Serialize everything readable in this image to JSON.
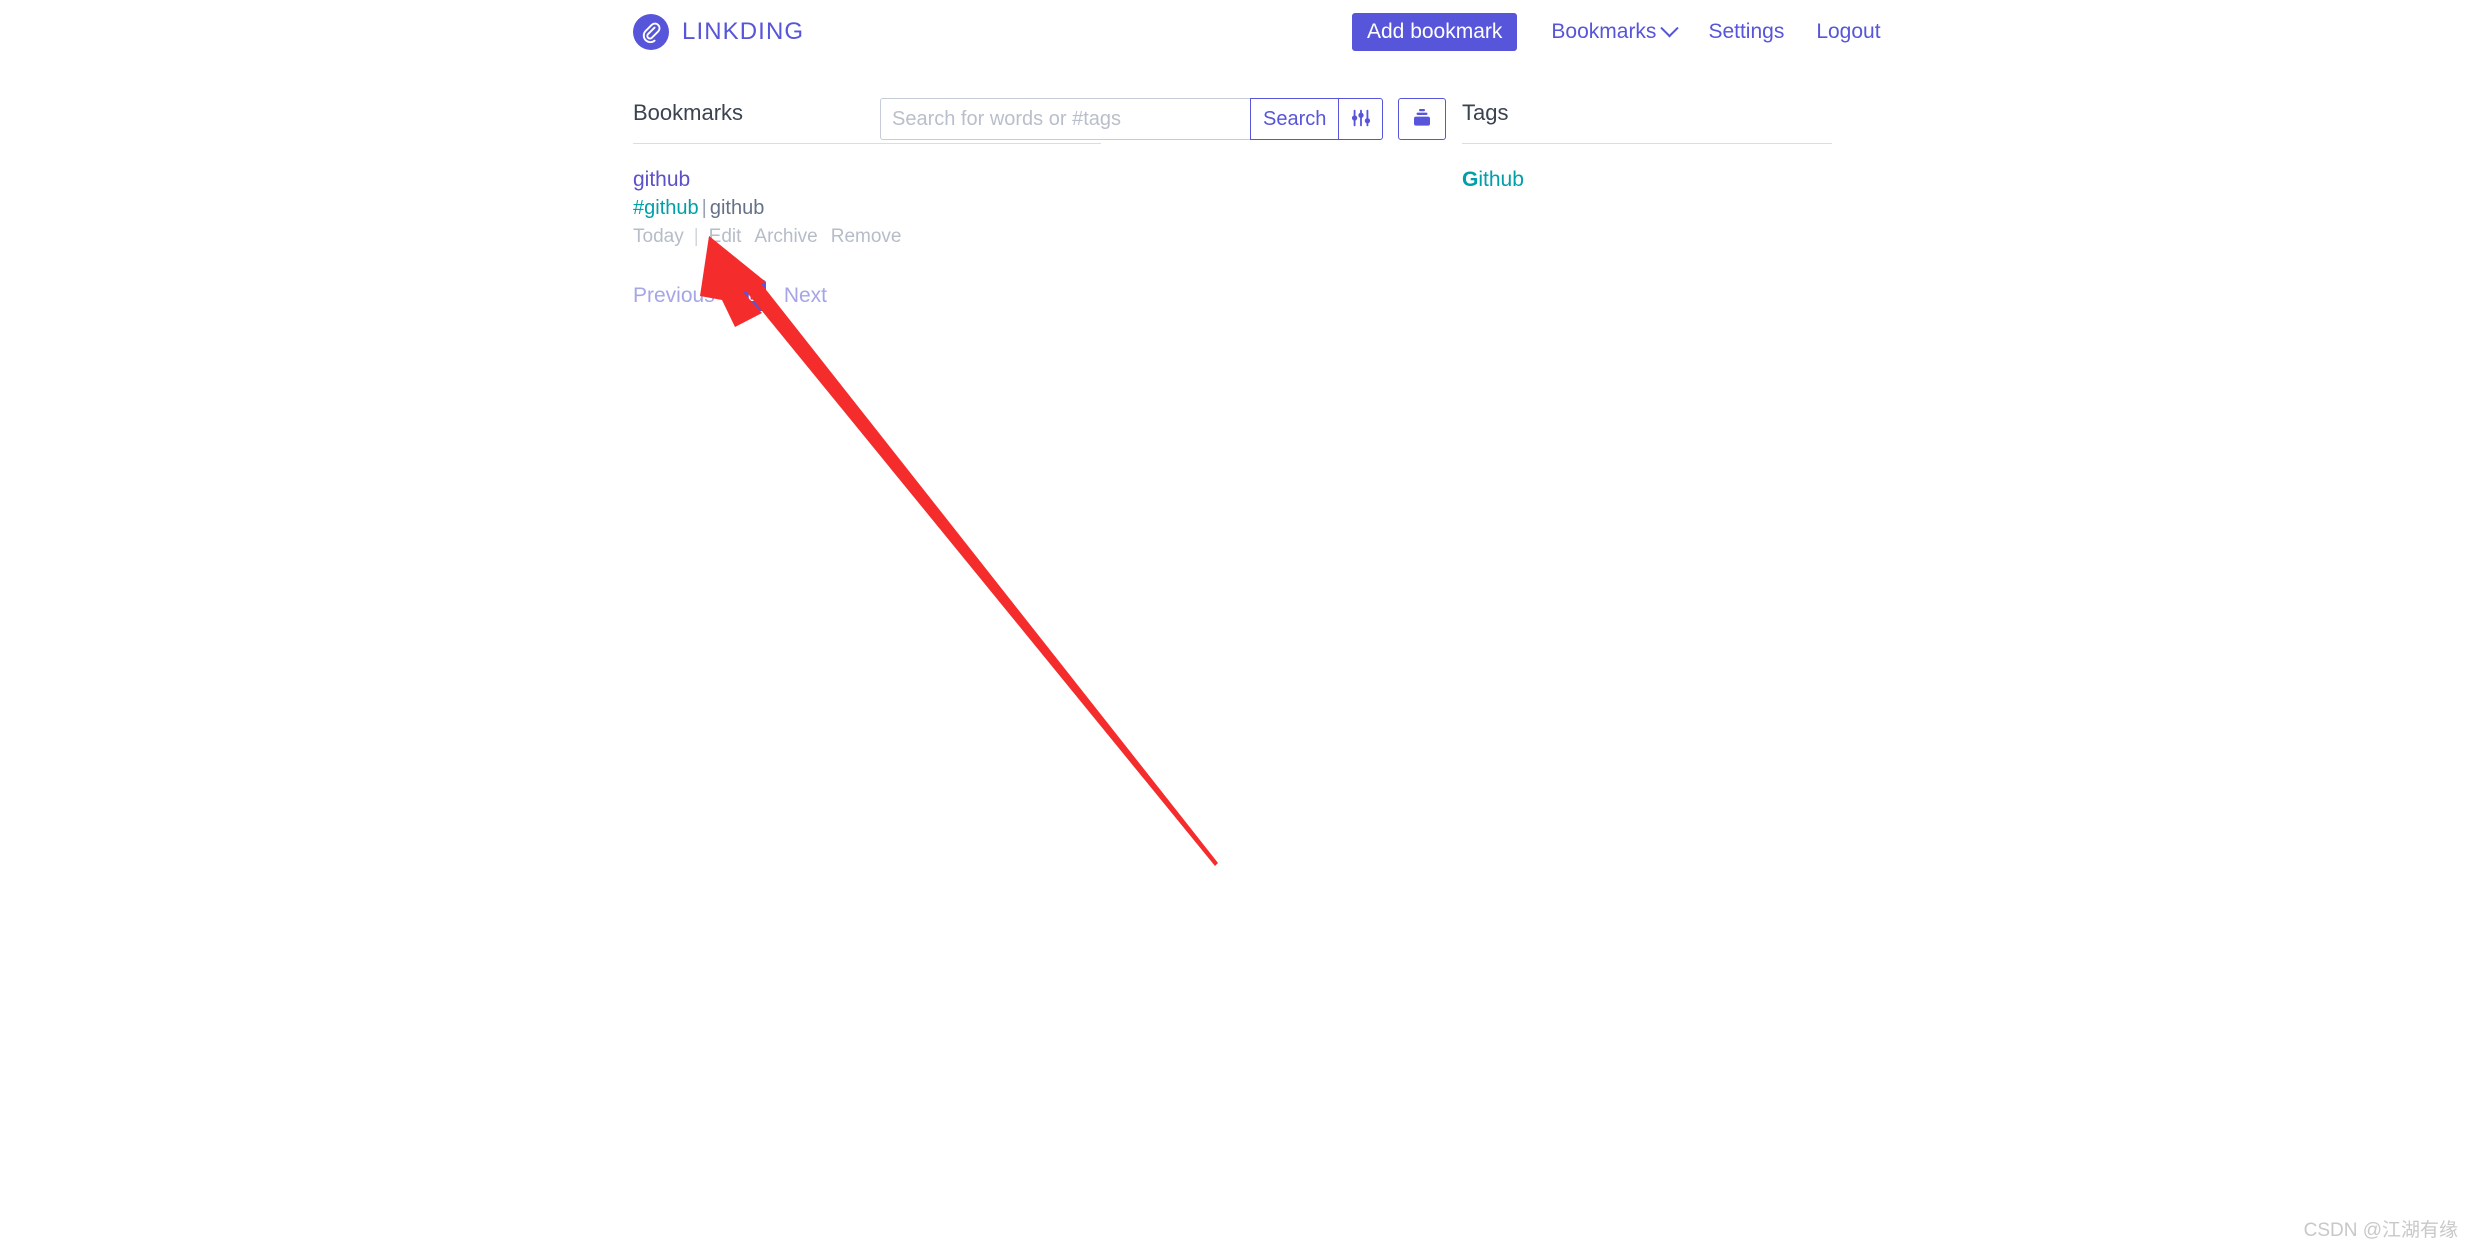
{
  "header": {
    "brand_name": "LINKDING",
    "logo_icon": "linkding-paperclip-logo",
    "nav": {
      "add_bookmark_label": "Add bookmark",
      "bookmarks_label": "Bookmarks",
      "bookmarks_chevron_icon": "chevron-down-icon",
      "settings_label": "Settings",
      "logout_label": "Logout"
    }
  },
  "search": {
    "placeholder": "Search for words or #tags",
    "value": "",
    "search_button_label": "Search",
    "filter_icon": "sliders-filter-icon",
    "bundles_icon": "bundles-stack-icon"
  },
  "main": {
    "section_title": "Bookmarks",
    "bookmarks": [
      {
        "title": "github",
        "tag": "#github",
        "separator": "|",
        "description": "github",
        "date": "Today",
        "actions": [
          "Edit",
          "Archive",
          "Remove"
        ]
      }
    ],
    "pagination": {
      "previous_label": "Previous",
      "current_page": "1",
      "next_label": "Next"
    }
  },
  "tags_panel": {
    "section_title": "Tags",
    "tags": [
      {
        "initial": "G",
        "rest": "ithub"
      }
    ]
  },
  "annotation": {
    "type": "red-arrow",
    "points_to": "Edit",
    "color": "#f52c2c"
  },
  "watermark": {
    "text": "CSDN @江湖有缘"
  },
  "colors": {
    "brand": "#5755d9",
    "tag": "#00a0a8",
    "muted": "#b6bcc8",
    "text": "#3b4351"
  }
}
